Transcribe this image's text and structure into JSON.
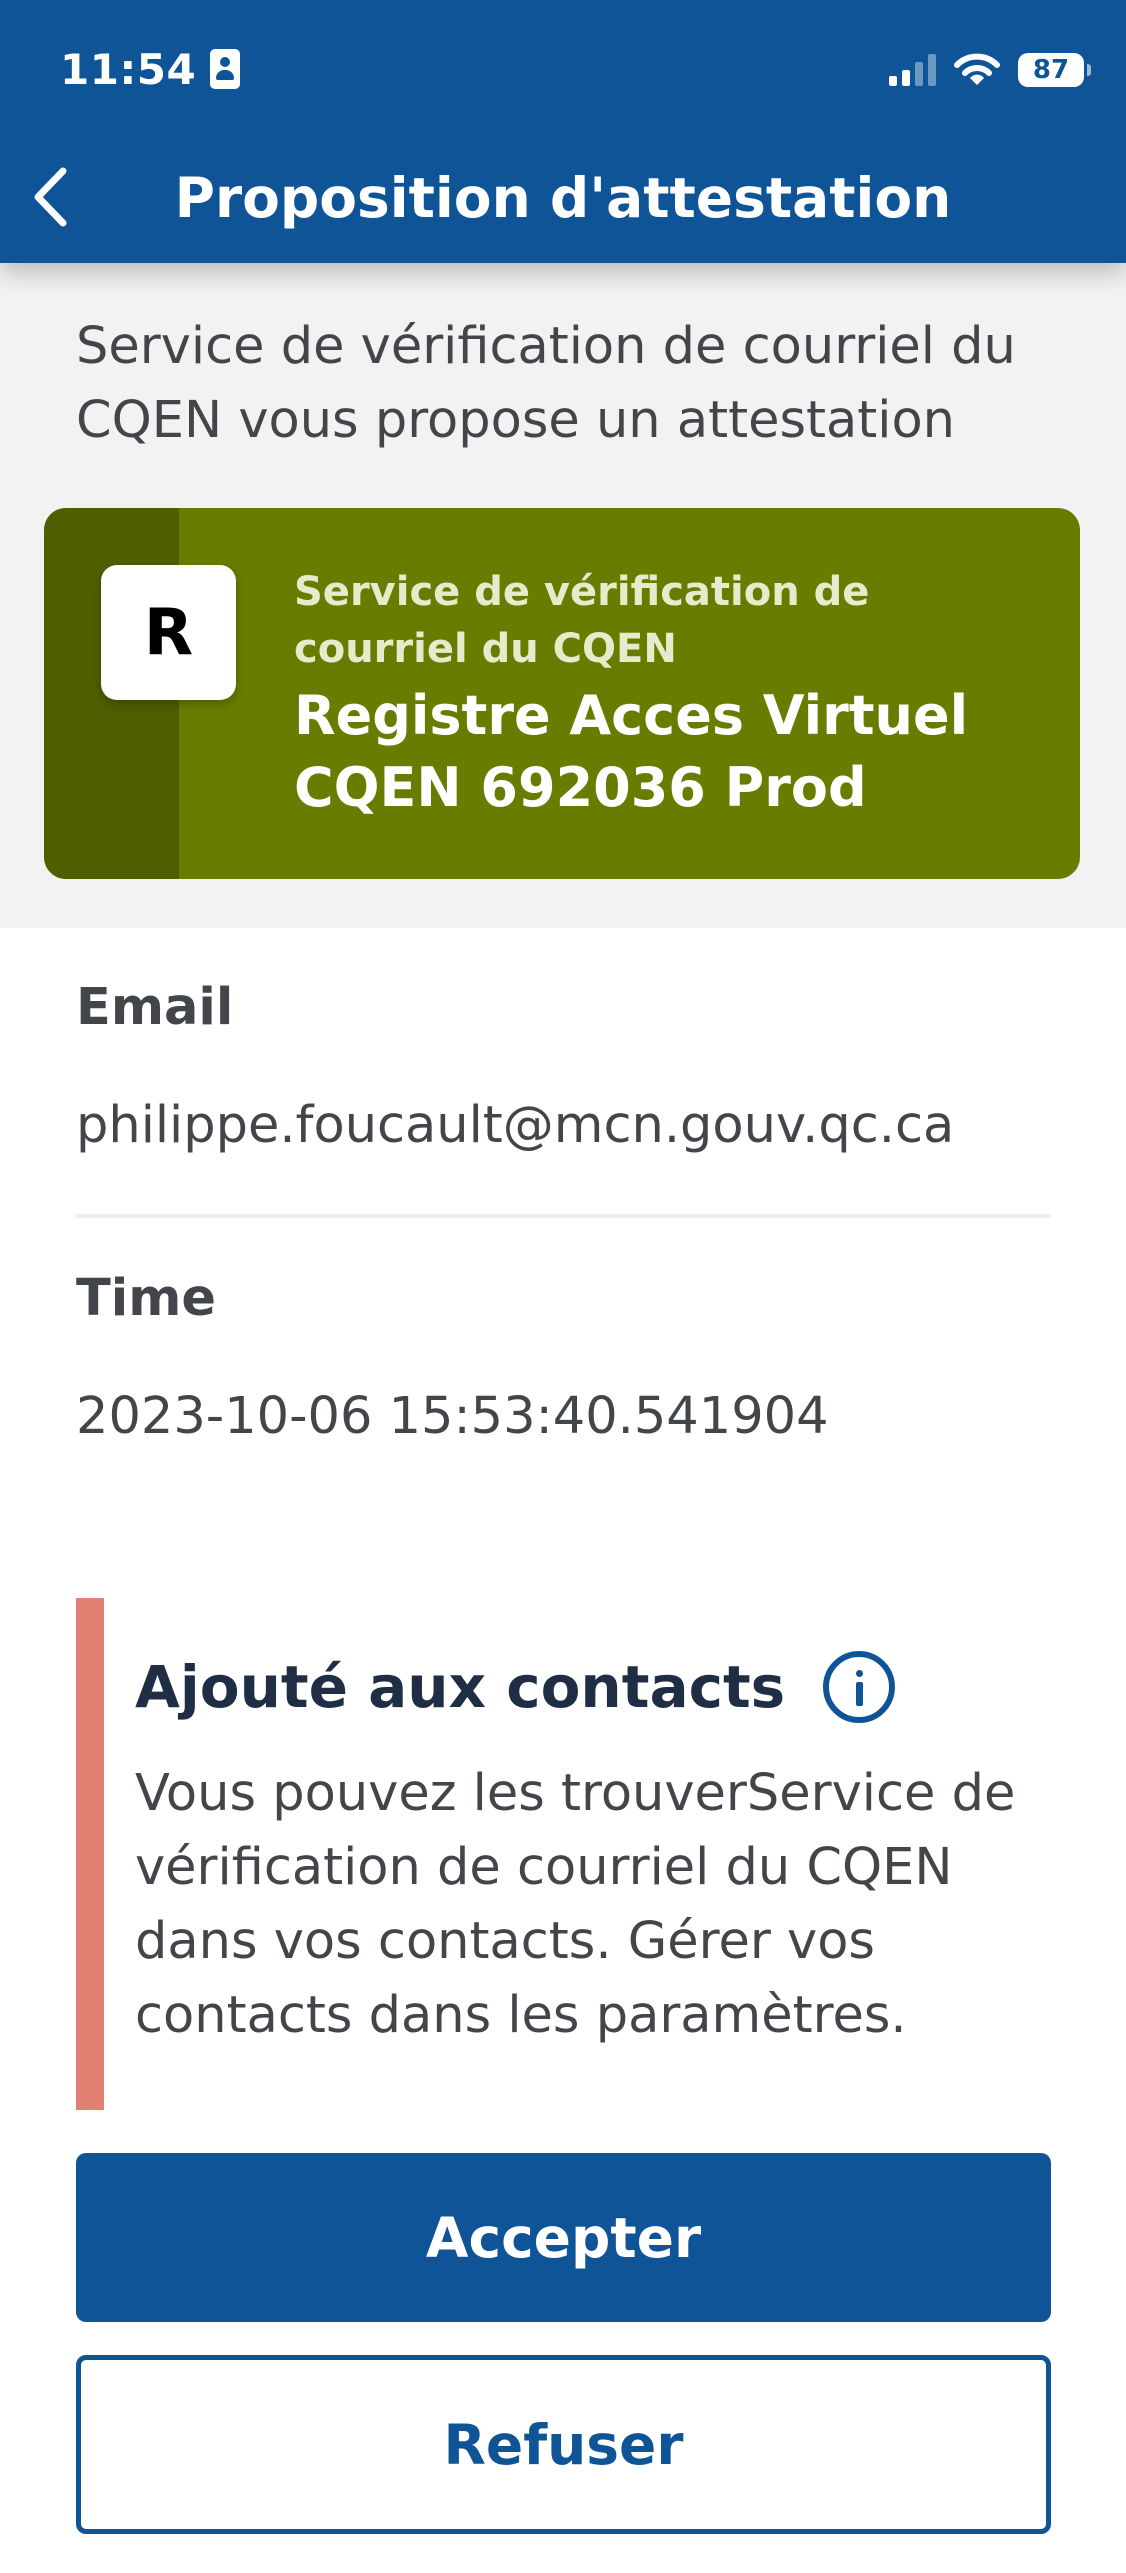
{
  "status_bar": {
    "time": "11:54",
    "battery": "87"
  },
  "header": {
    "title": "Proposition d'attestation"
  },
  "intro": {
    "text": "Service de vérification de courriel du CQEN vous propose un attestation"
  },
  "credential_card": {
    "logo_letter": "R",
    "issuer": "Service de vérification de courriel du CQEN",
    "name": "Registre Acces Virtuel CQEN 692036 Prod",
    "colors": {
      "card": "#6a7c00",
      "strip": "#4f5f00"
    }
  },
  "attributes": [
    {
      "label": "Email",
      "value": "philippe.foucault@mcn.gouv.qc.ca"
    },
    {
      "label": "Time",
      "value": "2023-10-06 15:53:40.541904"
    }
  ],
  "callout": {
    "title": "Ajouté aux contacts",
    "body": "Vous pouvez les trouverService de vérification de courriel du CQEN dans vos contacts. Gérer vos contacts dans les paramètres."
  },
  "actions": {
    "accept_label": "Accepter",
    "refuse_label": "Refuser"
  },
  "colors": {
    "primary": "#0f5496",
    "callout_accent": "#e38074"
  }
}
